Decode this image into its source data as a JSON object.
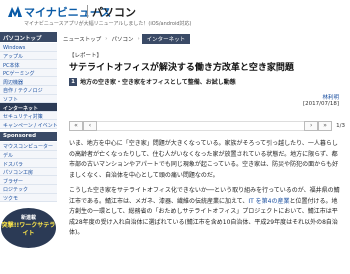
{
  "header": {
    "logo_text": "マイナビニュース",
    "section": "パソコン",
    "notice": "マイナビニュースアプリが大幅リニューアルしました！(iOS/android対応)"
  },
  "sidebar": {
    "heading": "パソコントップ",
    "items": [
      {
        "label": "Windows",
        "active": false
      },
      {
        "label": "アップル",
        "active": false
      },
      {
        "label": "PC本体",
        "active": false
      },
      {
        "label": "PCゲーミング",
        "active": false
      },
      {
        "label": "周辺機器",
        "active": false
      },
      {
        "label": "自作 / テクノロジ",
        "active": false
      },
      {
        "label": "ソフト",
        "active": false
      },
      {
        "label": "インターネット",
        "active": true
      },
      {
        "label": "セキュリティ対策",
        "active": false
      },
      {
        "label": "キャンペーン / イベント",
        "active": false
      }
    ],
    "sponsored_heading": "Sponsored",
    "sponsored_items": [
      {
        "label": "マウスコンピューター"
      },
      {
        "label": "デル"
      },
      {
        "label": "ドスパラ"
      },
      {
        "label": "パソコン工房"
      },
      {
        "label": "ブラザー"
      },
      {
        "label": "ロジテック"
      },
      {
        "label": "ツクモ"
      }
    ],
    "banner_line1": "新連載",
    "banner_line2": "突撃!!ワークサテライト"
  },
  "breadcrumb": {
    "items": [
      "ニューストップ",
      "パソコン",
      "インターネット"
    ]
  },
  "article": {
    "category": "【レポート】",
    "title": "サテライトオフィスが解決する働き方改革と空き家問題",
    "subtitle_num": "1",
    "subtitle": "地方の空き家・空き家をオフィスとして整備、お試し動態",
    "author": "林利明",
    "date": "[2017/07/18]"
  },
  "pager": {
    "first": "«",
    "prev": "‹",
    "next": "›",
    "last": "»",
    "count": "1/3"
  },
  "body": {
    "p1": "いま、地方を中心に「空き家」問題が大きくなっている。家族がそろって引っ越したり、一人暮らしの高齢者が亡くなったりして、住む人がいなくなった家が放置されている状態だ。地方に限らず、都市部の古いマンションやアパートでも同じ現象が起こっている。空き家は、防災や防犯の面からも好ましくなく、自治体を中心として頭の痛い問題なのだ。",
    "p2a": "こうした空き家をサテライトオフィス化できないか──という取り組みを行っているのが、福井県の鯖江市である。鯖江市は、メガネ、漆器、繊維の伝統産業に加えて、",
    "p2b": "IT を第4の産業",
    "p2c": "と位置付ける。地方創生の一環として、総務省の「おためしサテライトオフィス」プロジェクトにおいて、鯖江市は平成28年度の受け入れ自治体に選ばれている(鯖江市を含め10自治体、平成29年度はそれ以外の8自治体)。"
  }
}
